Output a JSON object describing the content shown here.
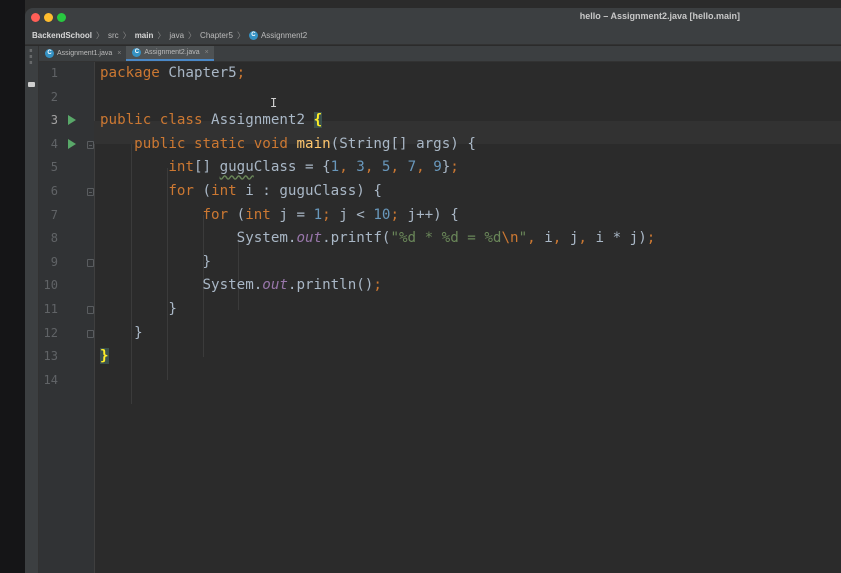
{
  "window": {
    "title": "hello – Assignment2.java [hello.main]"
  },
  "breadcrumb": [
    {
      "label": "BackendSchool",
      "bold": true,
      "icon": null
    },
    {
      "label": "src",
      "bold": false,
      "icon": null
    },
    {
      "label": "main",
      "bold": true,
      "icon": null
    },
    {
      "label": "java",
      "bold": false,
      "icon": null
    },
    {
      "label": "Chapter5",
      "bold": false,
      "icon": null
    },
    {
      "label": "Assignment2",
      "bold": false,
      "icon": "java-class-icon"
    }
  ],
  "breadcrumb_separator": "〉",
  "tool_strip": {
    "label": "Project"
  },
  "tabs": [
    {
      "label": "Assignment1.java",
      "active": false,
      "close": "×"
    },
    {
      "label": "Assignment2.java",
      "active": true,
      "close": "×"
    }
  ],
  "class_icon_letter": "C",
  "editor": {
    "current_line": 3,
    "lines": [
      {
        "n": "1",
        "text": "package Chapter5;"
      },
      {
        "n": "2",
        "text": ""
      },
      {
        "n": "3",
        "text": "public class Assignment2 {"
      },
      {
        "n": "4",
        "text": "    public static void main(String[] args) {"
      },
      {
        "n": "5",
        "text": "        int[] guguClass = {1, 3, 5, 7, 9};"
      },
      {
        "n": "6",
        "text": "        for (int i : guguClass) {"
      },
      {
        "n": "7",
        "text": "            for (int j = 1; j < 10; j++) {"
      },
      {
        "n": "8",
        "text": "                System.out.printf(\"%d * %d = %d\\n\", i, j, i * j);"
      },
      {
        "n": "9",
        "text": "            }"
      },
      {
        "n": "10",
        "text": "            System.out.println();"
      },
      {
        "n": "11",
        "text": "        }"
      },
      {
        "n": "12",
        "text": "    }"
      },
      {
        "n": "13",
        "text": "}"
      },
      {
        "n": "14",
        "text": ""
      }
    ],
    "tokens": {
      "l1": [
        [
          "kw",
          "package"
        ],
        [
          "p",
          " Chapter5"
        ],
        [
          "kw",
          ";"
        ]
      ],
      "l3": [
        [
          "kw",
          "public"
        ],
        [
          "p",
          " "
        ],
        [
          "kw",
          "class"
        ],
        [
          "p",
          " Assignment2 "
        ],
        [
          "brace",
          "{"
        ]
      ],
      "l4": [
        [
          "p",
          "    "
        ],
        [
          "kw",
          "public"
        ],
        [
          "p",
          " "
        ],
        [
          "kw",
          "static"
        ],
        [
          "p",
          " "
        ],
        [
          "kw",
          "void"
        ],
        [
          "p",
          " "
        ],
        [
          "fn",
          "main"
        ],
        [
          "p",
          "(String[] args) {"
        ]
      ],
      "l5": [
        [
          "p",
          "        "
        ],
        [
          "kw",
          "int"
        ],
        [
          "p",
          "[] "
        ],
        [
          "typo",
          "gugu"
        ],
        [
          "p",
          "Class = {"
        ],
        [
          "num",
          "1"
        ],
        [
          "kw",
          ","
        ],
        [
          "p",
          " "
        ],
        [
          "num",
          "3"
        ],
        [
          "kw",
          ","
        ],
        [
          "p",
          " "
        ],
        [
          "num",
          "5"
        ],
        [
          "kw",
          ","
        ],
        [
          "p",
          " "
        ],
        [
          "num",
          "7"
        ],
        [
          "kw",
          ","
        ],
        [
          "p",
          " "
        ],
        [
          "num",
          "9"
        ],
        [
          "p",
          "}"
        ],
        [
          "kw",
          ";"
        ]
      ],
      "l6": [
        [
          "p",
          "        "
        ],
        [
          "kw",
          "for"
        ],
        [
          "p",
          " ("
        ],
        [
          "kw",
          "int"
        ],
        [
          "p",
          " i : guguClass) {"
        ]
      ],
      "l7": [
        [
          "p",
          "            "
        ],
        [
          "kw",
          "for"
        ],
        [
          "p",
          " ("
        ],
        [
          "kw",
          "int"
        ],
        [
          "p",
          " j = "
        ],
        [
          "num",
          "1"
        ],
        [
          "kw",
          ";"
        ],
        [
          "p",
          " j < "
        ],
        [
          "num",
          "10"
        ],
        [
          "kw",
          ";"
        ],
        [
          "p",
          " j++) {"
        ]
      ],
      "l8": [
        [
          "p",
          "                System."
        ],
        [
          "fld",
          "out"
        ],
        [
          "p",
          ".printf("
        ],
        [
          "str",
          "\"%d * %d = %d"
        ],
        [
          "esc",
          "\\n"
        ],
        [
          "str",
          "\""
        ],
        [
          "kw",
          ","
        ],
        [
          "p",
          " i"
        ],
        [
          "kw",
          ","
        ],
        [
          "p",
          " j"
        ],
        [
          "kw",
          ","
        ],
        [
          "p",
          " i * j)"
        ],
        [
          "kw",
          ";"
        ]
      ],
      "l9": [
        [
          "p",
          "            }"
        ]
      ],
      "l10": [
        [
          "p",
          "            System."
        ],
        [
          "fld",
          "out"
        ],
        [
          "p",
          ".println()"
        ],
        [
          "kw",
          ";"
        ]
      ],
      "l11": [
        [
          "p",
          "        }"
        ]
      ],
      "l12": [
        [
          "p",
          "    }"
        ]
      ],
      "l13": [
        [
          "brace",
          "}"
        ]
      ]
    }
  },
  "colors": {
    "keyword": "#cc7832",
    "number": "#6897bb",
    "string": "#6a8759",
    "field": "#9876aa",
    "method": "#ffc66d",
    "text": "#a9b7c6",
    "run_icon": "#59a869"
  }
}
